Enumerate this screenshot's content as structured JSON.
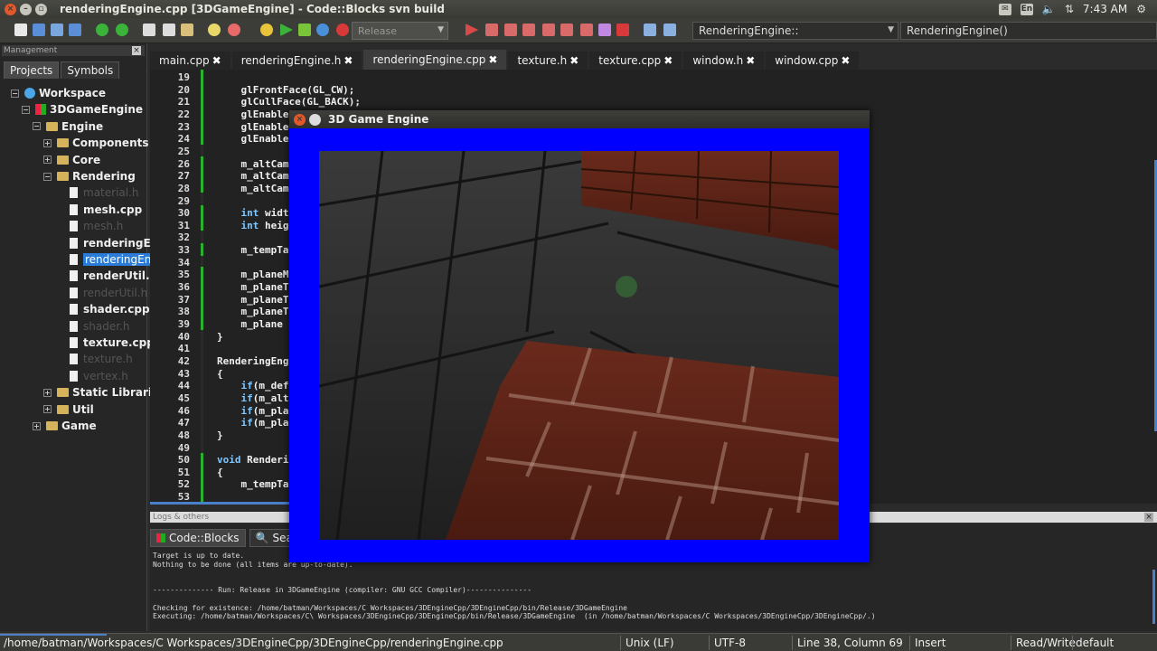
{
  "window": {
    "title": "renderingEngine.cpp [3DGameEngine] - Code::Blocks svn build",
    "clock": "7:43 AM",
    "lang_indicator": "En"
  },
  "toolbar": {
    "build_target": "Release",
    "scope_combo": "RenderingEngine::",
    "function_combo": "RenderingEngine()"
  },
  "management": {
    "title": "Management",
    "tabs": [
      "Projects",
      "Symbols"
    ],
    "tree": [
      {
        "label": "Workspace",
        "level": 0,
        "type": "workspace",
        "expander": "−"
      },
      {
        "label": "3DGameEngine",
        "level": 1,
        "type": "project",
        "expander": "−"
      },
      {
        "label": "Engine",
        "level": 2,
        "type": "folder",
        "expander": "−"
      },
      {
        "label": "Components",
        "level": 3,
        "type": "folder",
        "expander": "+"
      },
      {
        "label": "Core",
        "level": 3,
        "type": "folder",
        "expander": "+"
      },
      {
        "label": "Rendering",
        "level": 3,
        "type": "folder",
        "expander": "−"
      },
      {
        "label": "material.h",
        "level": 4,
        "type": "file",
        "dim": true
      },
      {
        "label": "mesh.cpp",
        "level": 4,
        "type": "file"
      },
      {
        "label": "mesh.h",
        "level": 4,
        "type": "file",
        "dim": true
      },
      {
        "label": "renderingEng",
        "level": 4,
        "type": "file"
      },
      {
        "label": "renderingEng",
        "level": 4,
        "type": "file",
        "selected": true
      },
      {
        "label": "renderUtil.cp",
        "level": 4,
        "type": "file"
      },
      {
        "label": "renderUtil.h",
        "level": 4,
        "type": "file",
        "dim": true
      },
      {
        "label": "shader.cpp",
        "level": 4,
        "type": "file"
      },
      {
        "label": "shader.h",
        "level": 4,
        "type": "file",
        "dim": true
      },
      {
        "label": "texture.cpp",
        "level": 4,
        "type": "file"
      },
      {
        "label": "texture.h",
        "level": 4,
        "type": "file",
        "dim": true
      },
      {
        "label": "vertex.h",
        "level": 4,
        "type": "file",
        "dim": true
      },
      {
        "label": "Static Libraries",
        "level": 3,
        "type": "folder",
        "expander": "+"
      },
      {
        "label": "Util",
        "level": 3,
        "type": "folder",
        "expander": "+"
      },
      {
        "label": "Game",
        "level": 2,
        "type": "folder",
        "expander": "+"
      }
    ]
  },
  "editor": {
    "tabs": [
      {
        "label": "main.cpp",
        "active": false
      },
      {
        "label": "renderingEngine.h",
        "active": false
      },
      {
        "label": "renderingEngine.cpp",
        "active": true
      },
      {
        "label": "texture.h",
        "active": false
      },
      {
        "label": "texture.cpp",
        "active": false
      },
      {
        "label": "window.h",
        "active": false
      },
      {
        "label": "window.cpp",
        "active": false
      }
    ],
    "close_glyph": "✖",
    "lines": [
      {
        "n": "19",
        "text": ""
      },
      {
        "n": "20",
        "text": "    glFrontFace(GL_CW);"
      },
      {
        "n": "21",
        "text": "    glCullFace(GL_BACK);"
      },
      {
        "n": "22",
        "text": "    glEnable("
      },
      {
        "n": "23",
        "text": "    glEnable("
      },
      {
        "n": "24",
        "text": "    glEnable("
      },
      {
        "n": "25",
        "text": ""
      },
      {
        "n": "26",
        "text": "    m_altCame"
      },
      {
        "n": "27",
        "text": "    m_altCame"
      },
      {
        "n": "28",
        "text": "    m_altCame"
      },
      {
        "n": "29",
        "text": ""
      },
      {
        "n": "30",
        "text": "    int width",
        "kw": "int"
      },
      {
        "n": "31",
        "text": "    int heigh",
        "kw": "int"
      },
      {
        "n": "32",
        "text": ""
      },
      {
        "n": "33",
        "text": "    m_tempTar"
      },
      {
        "n": "34",
        "text": ""
      },
      {
        "n": "35",
        "text": "    m_planeMa"
      },
      {
        "n": "36",
        "text": "    m_planeTr"
      },
      {
        "n": "37",
        "text": "    m_planeTr"
      },
      {
        "n": "38",
        "text": "    m_planeTr"
      },
      {
        "n": "39",
        "text": "    m_plane ="
      },
      {
        "n": "40",
        "text": "}"
      },
      {
        "n": "41",
        "text": ""
      },
      {
        "n": "42",
        "text": "RenderingEngi"
      },
      {
        "n": "43",
        "text": "{"
      },
      {
        "n": "44",
        "text": "    if(m_defa",
        "kw": "if"
      },
      {
        "n": "45",
        "text": "    if(m_altC",
        "kw": "if"
      },
      {
        "n": "46",
        "text": "    if(m_plan",
        "kw": "if"
      },
      {
        "n": "47",
        "text": "    if(m_plan",
        "kw": "if"
      },
      {
        "n": "48",
        "text": "}"
      },
      {
        "n": "49",
        "text": ""
      },
      {
        "n": "50",
        "text": "void Renderin",
        "kw": "void"
      },
      {
        "n": "51",
        "text": "{"
      },
      {
        "n": "52",
        "text": "    m_tempTar"
      },
      {
        "n": "53",
        "text": ""
      }
    ]
  },
  "logs": {
    "title": "Logs & others",
    "tabs": [
      "Code::Blocks",
      "Sea"
    ],
    "lines": [
      "Target is up to date.",
      "Nothing to be done (all items are up-to-date).",
      "",
      "",
      "-------------- Run: Release in 3DGameEngine (compiler: GNU GCC Compiler)---------------",
      "",
      "Checking for existence: /home/batman/Workspaces/C Workspaces/3DEngineCpp/3DEngineCpp/bin/Release/3DGameEngine",
      "Executing: /home/batman/Workspaces/C\\ Workspaces/3DEngineCpp/3DEngineCpp/bin/Release/3DGameEngine  (in /home/batman/Workspaces/C Workspaces/3DEngineCpp/3DEngineCpp/.)"
    ]
  },
  "statusbar": {
    "path": "/home/batman/Workspaces/C Workspaces/3DEngineCpp/3DEngineCpp/renderingEngine.cpp",
    "eol": "Unix (LF)",
    "encoding": "UTF-8",
    "position": "Line 38, Column 69",
    "mode": "Insert",
    "access": "Read/Write",
    "profile": "default"
  },
  "game_window": {
    "title": "3D Game Engine",
    "clear_color": "#0000ff"
  }
}
